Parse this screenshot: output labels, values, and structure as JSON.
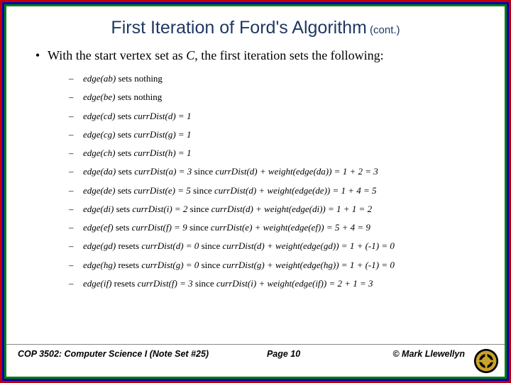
{
  "title": {
    "main": "First Iteration of Ford's Algorithm",
    "suffix": " (cont.)"
  },
  "bullet": {
    "marker": "•",
    "text_pre": "With the start vertex set as ",
    "text_C": "C",
    "text_post": ", the first iteration sets the following:"
  },
  "items": [
    {
      "edge": "edge(ab)",
      "verb": " sets ",
      "rest_plain": "nothing"
    },
    {
      "edge": "edge(be)",
      "verb": " sets ",
      "rest_plain": "nothing"
    },
    {
      "edge": "edge(cd)",
      "verb": " sets ",
      "rest_ital": "currDist(d) = 1"
    },
    {
      "edge": "edge(cg)",
      "verb": " sets ",
      "rest_ital": "currDist(g) = 1"
    },
    {
      "edge": "edge(ch)",
      "verb": " sets ",
      "rest_ital": "currDist(h) = 1"
    },
    {
      "edge": "edge(da)",
      "verb": " sets ",
      "rest_ital": "currDist(a) = 3",
      "since": " since ",
      "since_ital": "currDist(d) + weight(edge(da)) = 1 + 2 = 3"
    },
    {
      "edge": "edge(de)",
      "verb": " sets ",
      "rest_ital": "currDist(e) = 5",
      "since": " since ",
      "since_ital": "currDist(d) + weight(edge(de)) = 1 + 4 = 5"
    },
    {
      "edge": "edge(di)",
      "verb": " sets ",
      "rest_ital": "currDist(i) = 2",
      "since": " since ",
      "since_ital": "currDist(d) + weight(edge(di)) = 1 + 1 = 2"
    },
    {
      "edge": "edge(ef)",
      "verb": " sets ",
      "rest_ital": "currDist(f) = 9",
      "since": " since ",
      "since_ital": "currDist(e) + weight(edge(ef)) = 5 + 4 = 9"
    },
    {
      "edge": "edge(gd)",
      "verb": " resets ",
      "rest_ital": "currDist(d) = 0",
      "since": " since ",
      "since_ital": "currDist(d) + weight(edge(gd)) = 1 + (-1) = 0"
    },
    {
      "edge": "edge(hg)",
      "verb": " resets ",
      "rest_ital": "currDist(g) = 0",
      "since": " since ",
      "since_ital": "currDist(g) + weight(edge(hg)) = 1 + (-1) = 0"
    },
    {
      "edge": "edge(if)",
      "verb": " resets ",
      "rest_ital": "currDist(f) = 3",
      "since": " since ",
      "since_ital": "currDist(i) + weight(edge(if)) = 2 + 1 = 3"
    }
  ],
  "footer": {
    "course": "COP 3502: Computer Science I   (Note Set #25)",
    "page": "Page 10",
    "author": "© Mark Llewellyn"
  },
  "dash": "–"
}
